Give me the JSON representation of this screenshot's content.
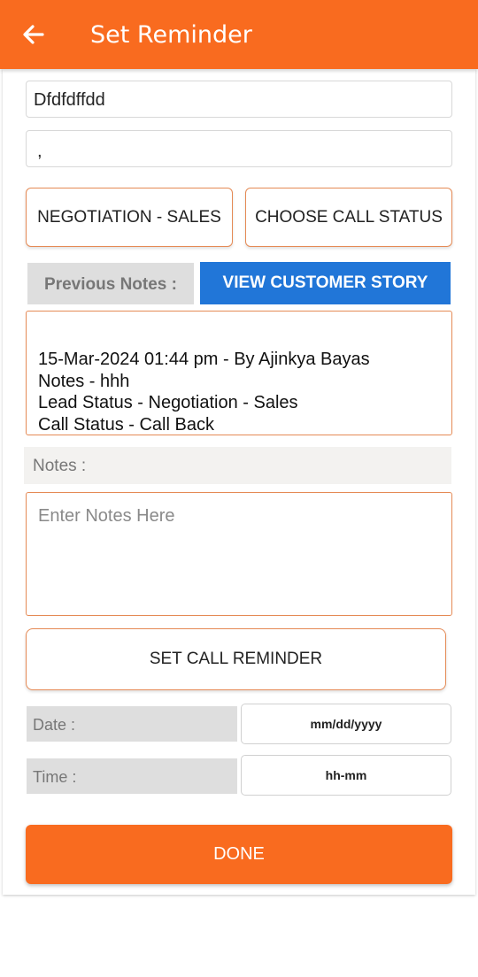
{
  "appbar": {
    "title": "Set Reminder",
    "back_icon": "arrow-left-icon",
    "color": "#f96b1f"
  },
  "form": {
    "name_value": "Dfdfdffdd",
    "second_value": ",",
    "lead_status_button": "NEGOTIATION - SALES",
    "call_status_button": "CHOOSE CALL STATUS"
  },
  "previous_notes": {
    "label": "Previous Notes :",
    "view_story_button": "VIEW CUSTOMER STORY",
    "content": "15-Mar-2024 01:44 pm - By Ajinkya Bayas\nNotes - hhh\nLead Status - Negotiation - Sales\nCall Status - Call Back"
  },
  "notes": {
    "label": "Notes :",
    "placeholder": "Enter Notes Here"
  },
  "reminder": {
    "button": "SET CALL REMINDER",
    "date_label": "Date :",
    "date_value": "mm/dd/yyyy",
    "time_label": "Time :",
    "time_value": "hh-mm"
  },
  "done_button": "DONE",
  "colors": {
    "accent": "#f96b1f",
    "blue": "#2176d8",
    "outline": "#e58a55"
  }
}
